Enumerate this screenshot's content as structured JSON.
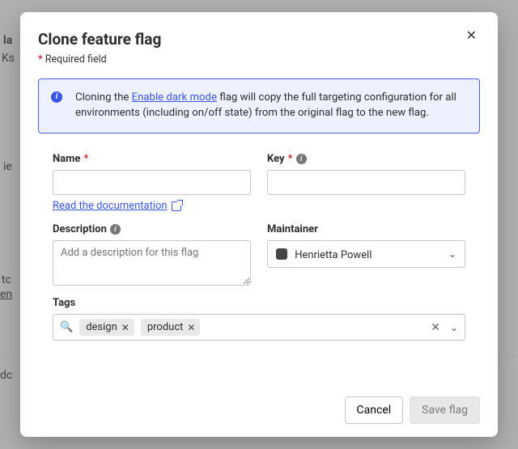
{
  "bg": {
    "t1": "la",
    "t2": "Ks",
    "t3": "ie",
    "t4": "tc",
    "t5": "en",
    "t6": "dc"
  },
  "modal": {
    "title": "Clone feature flag",
    "required_note_prefix": "*",
    "required_note": " Required field",
    "info": {
      "pre": "Cloning the ",
      "link": "Enable dark mode",
      "post": " flag will copy the full targeting configuration for all environments (including on/off state) from the original flag to the new flag."
    },
    "fields": {
      "name": {
        "label": "Name",
        "value": "",
        "doc_link": "Read the documentation"
      },
      "key": {
        "label": "Key",
        "value": ""
      },
      "description": {
        "label": "Description",
        "placeholder": "Add a description for this flag",
        "value": ""
      },
      "maintainer": {
        "label": "Maintainer",
        "value": "Henrietta Powell"
      },
      "tags": {
        "label": "Tags",
        "items": [
          "design",
          "product"
        ]
      }
    },
    "buttons": {
      "cancel": "Cancel",
      "save": "Save flag"
    }
  }
}
